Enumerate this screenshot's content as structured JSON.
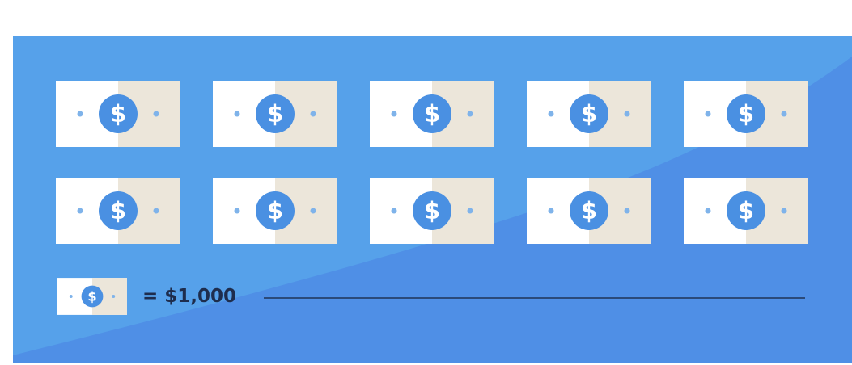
{
  "legend": {
    "value_label": "= $1,000"
  },
  "bills": {
    "count": 10,
    "rows": 2,
    "per_row": 5,
    "icon": "dollar-bill-icon",
    "symbol": "$"
  },
  "colors": {
    "panel_light": "#56a1ea",
    "panel_dark": "#4f8fe6",
    "bill_white": "#ffffff",
    "bill_beige": "#ece6da",
    "coin_blue": "#4a90e2",
    "coin_symbol": "#ffffff",
    "dot": "#7fb3ea",
    "text_dark": "#1e2d4d",
    "rule": "#2b4a7a"
  }
}
